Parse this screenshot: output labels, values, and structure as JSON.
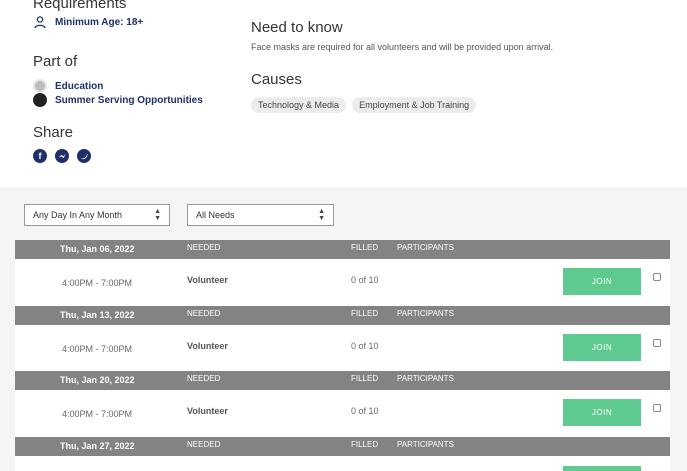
{
  "requirements": {
    "title": "Requirements",
    "min_age": "Minimum Age: 18+"
  },
  "part_of": {
    "title": "Part of",
    "items": [
      "Education",
      "Summer Serving Opportunities"
    ]
  },
  "share": {
    "title": "Share",
    "icons": [
      "facebook-icon",
      "messenger-icon",
      "twitter-icon"
    ]
  },
  "need_to_know": {
    "title": "Need to know",
    "text": "Face masks are required for all volunteers and will be provided upon arrival."
  },
  "causes": {
    "title": "Causes",
    "tags": [
      "Technology & Media",
      "Employment & Job Training"
    ]
  },
  "filters": {
    "day": "Any Day In Any Month",
    "needs": "All Needs"
  },
  "table": {
    "headers": {
      "needed": "NEEDED",
      "filled": "FILLED",
      "participants": "PARTICIPANTS"
    },
    "join_label": "JOIN",
    "dates": [
      {
        "date": "Thu, Jan 06, 2022",
        "time": "4:00PM - 7:00PM",
        "role": "Volunteer",
        "filled": "0 of 10"
      },
      {
        "date": "Thu, Jan 13, 2022",
        "time": "4:00PM - 7:00PM",
        "role": "Volunteer",
        "filled": "0 of 10"
      },
      {
        "date": "Thu, Jan 20, 2022",
        "time": "4:00PM - 7:00PM",
        "role": "Volunteer",
        "filled": "0 of 10"
      },
      {
        "date": "Thu, Jan 27, 2022"
      }
    ]
  }
}
